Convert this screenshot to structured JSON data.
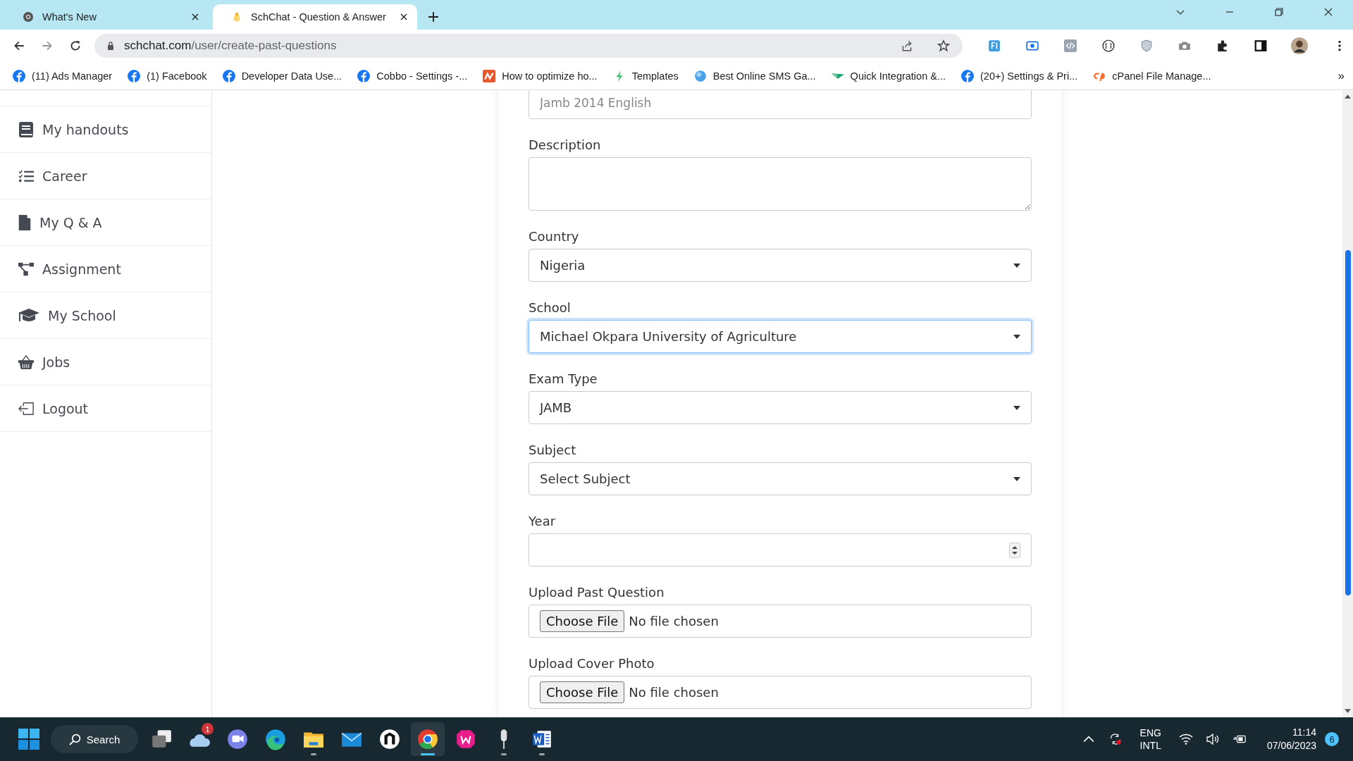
{
  "browser": {
    "tabs": [
      {
        "title": "What's New",
        "kind": "chrome",
        "selected": false
      },
      {
        "title": "SchChat - Question & Answer",
        "kind": "schchat",
        "selected": true
      }
    ],
    "url": {
      "domain": "schchat.com",
      "path": "/user/create-past-questions"
    },
    "bookmarks": [
      {
        "label": "(11) Ads Manager",
        "kind": "facebook"
      },
      {
        "label": "(1) Facebook",
        "kind": "facebook"
      },
      {
        "label": "Developer Data Use...",
        "kind": "facebook"
      },
      {
        "label": "Cobbo - Settings -...",
        "kind": "facebook"
      },
      {
        "label": "How to optimize ho...",
        "kind": "orange"
      },
      {
        "label": "Templates",
        "kind": "leaf"
      },
      {
        "label": "Best Online SMS Ga...",
        "kind": "globe"
      },
      {
        "label": "Quick Integration &...",
        "kind": "bird"
      },
      {
        "label": "(20+) Settings & Pri...",
        "kind": "facebook"
      },
      {
        "label": "cPanel File Manage...",
        "kind": "cpanel"
      }
    ],
    "bookmarks_more": "»"
  },
  "sidebar": {
    "items": [
      {
        "label": "My handouts",
        "kind": "book"
      },
      {
        "label": "Career",
        "kind": "list"
      },
      {
        "label": "My Q & A",
        "kind": "file"
      },
      {
        "label": "Assignment",
        "kind": "tree"
      },
      {
        "label": "My School",
        "kind": "cap"
      },
      {
        "label": "Jobs",
        "kind": "basket"
      },
      {
        "label": "Logout",
        "kind": "logout"
      }
    ]
  },
  "form": {
    "fields": [
      {
        "kind": "text",
        "placeholder": "Jamb 2014 English",
        "focused": false
      },
      {
        "kind": "textarea",
        "label": "Description",
        "focused": false
      },
      {
        "kind": "select",
        "label": "Country",
        "value": "Nigeria",
        "focused": false
      },
      {
        "kind": "select",
        "label": "School",
        "value": "Michael Okpara University of Agriculture",
        "focused": true
      },
      {
        "kind": "select",
        "label": "Exam Type",
        "value": "JAMB",
        "focused": false
      },
      {
        "kind": "select",
        "label": "Subject",
        "value": "Select Subject",
        "focused": false
      },
      {
        "kind": "number",
        "label": "Year",
        "focused": false
      },
      {
        "kind": "file",
        "label": "Upload Past Question",
        "button": "Choose File",
        "status": "No file chosen",
        "focused": false
      },
      {
        "kind": "file",
        "label": "Upload Cover Photo",
        "button": "Choose File",
        "status": "No file chosen",
        "focused": false
      }
    ]
  },
  "taskbar": {
    "search": "Search",
    "apps": [
      {
        "kind": "taskview",
        "running": false,
        "selected": false
      },
      {
        "kind": "weather",
        "badge": "1",
        "running": false,
        "selected": false
      },
      {
        "kind": "chat",
        "running": false,
        "selected": false
      },
      {
        "kind": "edge",
        "running": false,
        "selected": false
      },
      {
        "kind": "folder",
        "running": true,
        "selected": false
      },
      {
        "kind": "mail",
        "running": false,
        "selected": false
      },
      {
        "kind": "hex",
        "running": false,
        "selected": false
      },
      {
        "kind": "chrome",
        "running": true,
        "selected": true
      },
      {
        "kind": "wamp",
        "running": false,
        "selected": false
      },
      {
        "kind": "mic",
        "running": true,
        "selected": false
      },
      {
        "kind": "word",
        "running": true,
        "selected": false
      }
    ],
    "language": [
      "ENG",
      "INTL"
    ],
    "time": "11:14",
    "date": "07/06/2023",
    "notifications": "6"
  }
}
